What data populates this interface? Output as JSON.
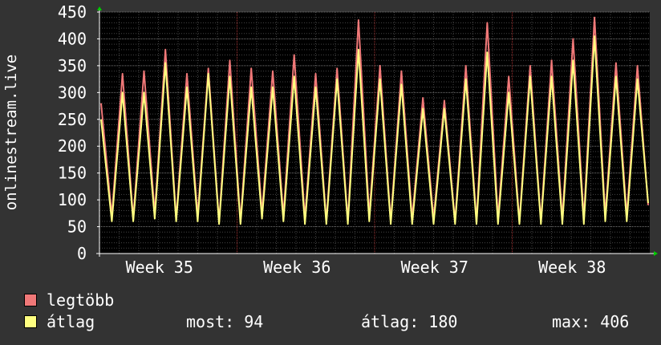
{
  "chart_data": {
    "type": "line",
    "ylabel": "onlinestream.live",
    "ylim": [
      0,
      450
    ],
    "yticks": [
      0,
      50,
      100,
      150,
      200,
      250,
      300,
      350,
      400,
      450
    ],
    "x_tick_labels": [
      "Week 35",
      "Week 36",
      "Week 37",
      "Week 38"
    ],
    "grid": true,
    "legend_position": "bottom-left",
    "series": [
      {
        "name": "legtöbb",
        "color": "#f07878",
        "values": [
          280,
          70,
          335,
          65,
          340,
          75,
          380,
          65,
          335,
          70,
          345,
          60,
          360,
          60,
          345,
          75,
          340,
          70,
          370,
          65,
          335,
          60,
          345,
          60,
          435,
          70,
          350,
          60,
          340,
          65,
          290,
          65,
          285,
          60,
          350,
          60,
          430,
          65,
          330,
          60,
          350,
          60,
          360,
          65,
          400,
          65,
          440,
          70,
          355,
          70,
          350,
          90
        ]
      },
      {
        "name": "átlag",
        "color": "#ffff80",
        "values": [
          250,
          60,
          300,
          60,
          300,
          65,
          355,
          60,
          310,
          60,
          335,
          55,
          330,
          55,
          310,
          65,
          310,
          60,
          330,
          55,
          310,
          55,
          325,
          55,
          380,
          60,
          325,
          55,
          315,
          55,
          270,
          55,
          270,
          55,
          325,
          55,
          375,
          55,
          300,
          55,
          330,
          55,
          330,
          55,
          360,
          55,
          405,
          60,
          330,
          60,
          325,
          94
        ]
      }
    ]
  },
  "legend": {
    "max_label": "legtöbb",
    "avg_label": "átlag"
  },
  "stats": {
    "now": "most: 94",
    "avg": "átlag: 180",
    "max": "max: 406"
  }
}
